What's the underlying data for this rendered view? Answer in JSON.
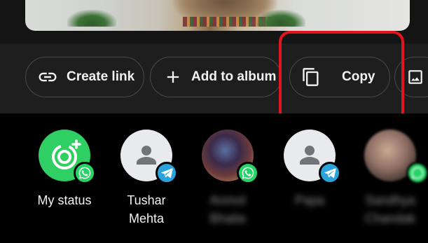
{
  "actions": {
    "create_link": {
      "label": "Create link",
      "icon": "link-icon"
    },
    "add_to_album": {
      "label": "Add to album",
      "icon": "plus-icon"
    },
    "copy": {
      "label": "Copy",
      "icon": "copy-icon"
    },
    "next": {
      "label": "",
      "icon": "image-icon"
    }
  },
  "highlight_color": "#e3141b",
  "contacts": [
    {
      "name": "My status",
      "badge": "whatsapp-icon"
    },
    {
      "name_line1": "Tushar",
      "name_line2": "Mehta",
      "badge": "telegram-icon"
    },
    {
      "name_line1": "Anmol",
      "name_line2": "Bhatia",
      "badge": "whatsapp-icon"
    },
    {
      "name": "Papa",
      "badge": "telegram-icon"
    },
    {
      "name_line1": "Sandhya",
      "name_line2": "Chandak",
      "badge": "whatsapp-icon"
    }
  ],
  "colors": {
    "whatsapp": "#25d366",
    "telegram": "#2aa3dd",
    "status_green": "#2fcf63"
  }
}
